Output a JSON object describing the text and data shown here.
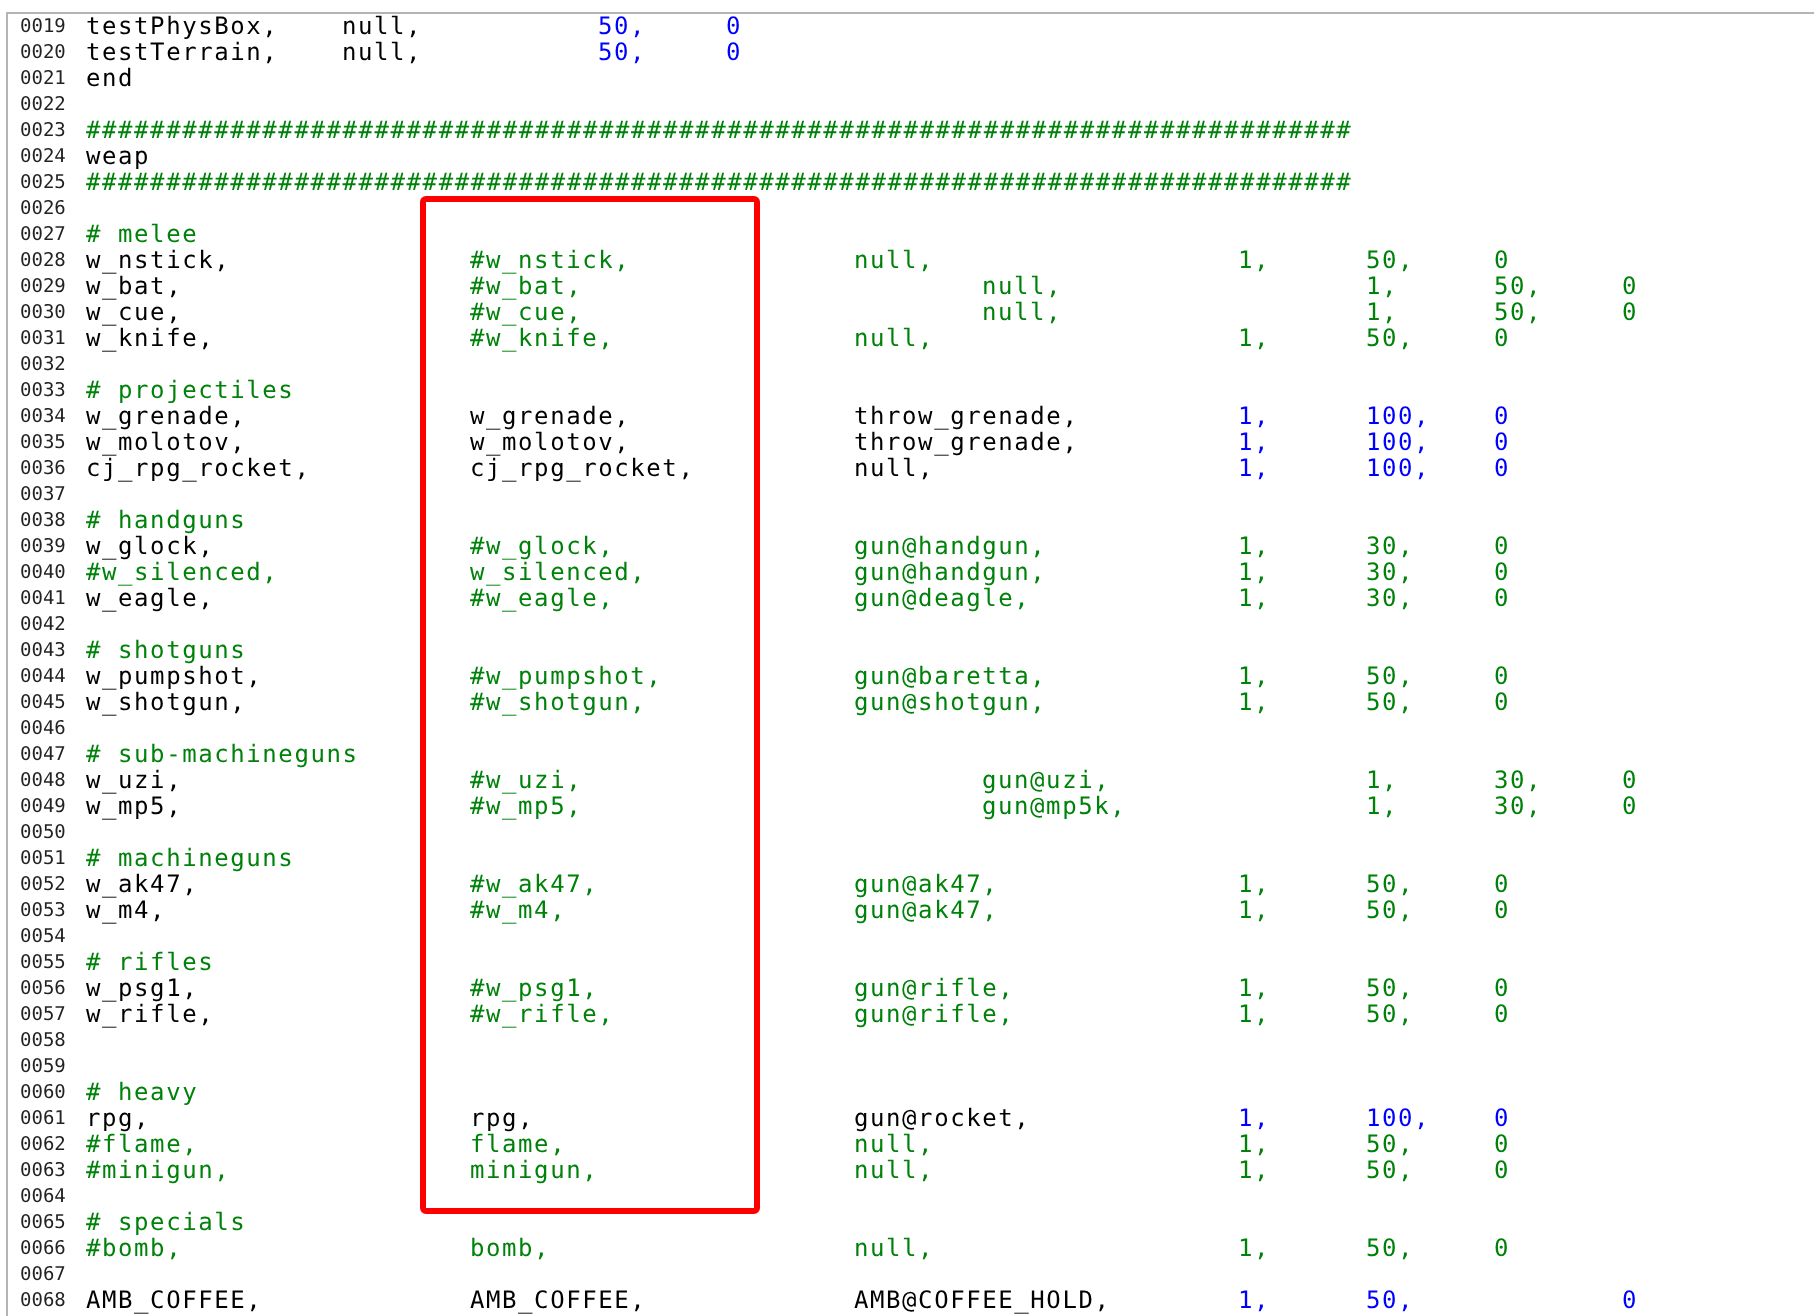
{
  "editor": {
    "sections": [
      {
        "boxed": false,
        "lines": [
          {
            "number": "0019",
            "tokens": [
              {
                "text": "testPhysBox,",
                "kind": "plain"
              },
              {
                "text": "\tnull,",
                "kind": "plain"
              },
              {
                "text": "\t\t50,",
                "kind": "number"
              },
              {
                "text": "\t0",
                "kind": "number"
              }
            ]
          },
          {
            "number": "0020",
            "tokens": [
              {
                "text": "testTerrain,",
                "kind": "plain"
              },
              {
                "text": "\tnull,",
                "kind": "plain"
              },
              {
                "text": "\t\t50,",
                "kind": "number"
              },
              {
                "text": "\t0",
                "kind": "number"
              }
            ]
          },
          {
            "number": "0021",
            "tokens": [
              {
                "text": "end",
                "kind": "plain"
              }
            ]
          },
          {
            "number": "0022"
          },
          {
            "number": "0023",
            "tokens": [
              {
                "text": "###############################################################################",
                "kind": "comment"
              }
            ]
          },
          {
            "number": "0024",
            "tokens": [
              {
                "text": "weap",
                "kind": "plain"
              }
            ]
          },
          {
            "number": "0025",
            "tokens": [
              {
                "text": "###############################################################################",
                "kind": "comment"
              }
            ]
          }
        ]
      },
      {
        "boxed": true,
        "lines": [
          {
            "number": "0026"
          },
          {
            "number": "0027",
            "tokens": [
              {
                "text": "# melee",
                "kind": "comment"
              }
            ]
          },
          {
            "number": "0028",
            "tokens": [
              {
                "text": "w_nstick,",
                "kind": "plain"
              },
              {
                "text": "\t\t#w_nstick,",
                "kind": "comment"
              },
              {
                "text": "\t\tnull,",
                "kind": "comment"
              },
              {
                "text": "\t\t\t1,",
                "kind": "comment"
              },
              {
                "text": "\t50,",
                "kind": "comment"
              },
              {
                "text": "\t0",
                "kind": "comment"
              }
            ]
          },
          {
            "number": "0029",
            "tokens": [
              {
                "text": "w_bat,",
                "kind": "plain"
              },
              {
                "text": "\t\t\t#w_bat,",
                "kind": "comment"
              },
              {
                "text": "\t\t\t\tnull,",
                "kind": "comment"
              },
              {
                "text": "\t\t\t1,",
                "kind": "comment"
              },
              {
                "text": "\t50,",
                "kind": "comment"
              },
              {
                "text": "\t0",
                "kind": "comment"
              }
            ]
          },
          {
            "number": "0030",
            "tokens": [
              {
                "text": "w_cue,",
                "kind": "plain"
              },
              {
                "text": "\t\t\t#w_cue,",
                "kind": "comment"
              },
              {
                "text": "\t\t\t\tnull,",
                "kind": "comment"
              },
              {
                "text": "\t\t\t1,",
                "kind": "comment"
              },
              {
                "text": "\t50,",
                "kind": "comment"
              },
              {
                "text": "\t0",
                "kind": "comment"
              }
            ]
          },
          {
            "number": "0031",
            "tokens": [
              {
                "text": "w_knife,",
                "kind": "plain"
              },
              {
                "text": "\t\t#w_knife,",
                "kind": "comment"
              },
              {
                "text": "\t\tnull,",
                "kind": "comment"
              },
              {
                "text": "\t\t\t1,",
                "kind": "comment"
              },
              {
                "text": "\t50,",
                "kind": "comment"
              },
              {
                "text": "\t0",
                "kind": "comment"
              }
            ]
          },
          {
            "number": "0032"
          },
          {
            "number": "0033",
            "tokens": [
              {
                "text": "# projectiles",
                "kind": "comment"
              }
            ]
          },
          {
            "number": "0034",
            "tokens": [
              {
                "text": "w_grenade,",
                "kind": "plain"
              },
              {
                "text": "\t\tw_grenade,",
                "kind": "plain"
              },
              {
                "text": "\t\tthrow_grenade,",
                "kind": "plain"
              },
              {
                "text": "\t\t1,",
                "kind": "number"
              },
              {
                "text": "\t100,",
                "kind": "number"
              },
              {
                "text": "\t0",
                "kind": "number"
              }
            ]
          },
          {
            "number": "0035",
            "tokens": [
              {
                "text": "w_molotov,",
                "kind": "plain"
              },
              {
                "text": "\t\tw_molotov,",
                "kind": "plain"
              },
              {
                "text": "\t\tthrow_grenade,",
                "kind": "plain"
              },
              {
                "text": "\t\t1,",
                "kind": "number"
              },
              {
                "text": "\t100,",
                "kind": "number"
              },
              {
                "text": "\t0",
                "kind": "number"
              }
            ]
          },
          {
            "number": "0036",
            "tokens": [
              {
                "text": "cj_rpg_rocket,",
                "kind": "plain"
              },
              {
                "text": "\t\tcj_rpg_rocket,",
                "kind": "plain"
              },
              {
                "text": "\t\tnull,",
                "kind": "plain"
              },
              {
                "text": "\t\t\t1,",
                "kind": "number"
              },
              {
                "text": "\t100,",
                "kind": "number"
              },
              {
                "text": "\t0",
                "kind": "number"
              }
            ]
          },
          {
            "number": "0037"
          },
          {
            "number": "0038",
            "tokens": [
              {
                "text": "# handguns",
                "kind": "comment"
              }
            ]
          },
          {
            "number": "0039",
            "tokens": [
              {
                "text": "w_glock,",
                "kind": "plain"
              },
              {
                "text": "\t\t#w_glock,",
                "kind": "comment"
              },
              {
                "text": "\t\tgun@handgun,",
                "kind": "comment"
              },
              {
                "text": "\t\t1,",
                "kind": "comment"
              },
              {
                "text": "\t30,",
                "kind": "comment"
              },
              {
                "text": "\t0",
                "kind": "comment"
              }
            ]
          },
          {
            "number": "0040",
            "tokens": [
              {
                "text": "#w_silenced,",
                "kind": "comment"
              },
              {
                "text": "\t\tw_silenced,",
                "kind": "comment"
              },
              {
                "text": "\t\tgun@handgun,",
                "kind": "comment"
              },
              {
                "text": "\t\t1,",
                "kind": "comment"
              },
              {
                "text": "\t30,",
                "kind": "comment"
              },
              {
                "text": "\t0",
                "kind": "comment"
              }
            ]
          },
          {
            "number": "0041",
            "tokens": [
              {
                "text": "w_eagle,",
                "kind": "plain"
              },
              {
                "text": "\t\t#w_eagle,",
                "kind": "comment"
              },
              {
                "text": "\t\tgun@deagle,",
                "kind": "comment"
              },
              {
                "text": "\t\t1,",
                "kind": "comment"
              },
              {
                "text": "\t30,",
                "kind": "comment"
              },
              {
                "text": "\t0",
                "kind": "comment"
              }
            ]
          },
          {
            "number": "0042"
          },
          {
            "number": "0043",
            "tokens": [
              {
                "text": "# shotguns",
                "kind": "comment"
              }
            ]
          },
          {
            "number": "0044",
            "tokens": [
              {
                "text": "w_pumpshot,",
                "kind": "plain"
              },
              {
                "text": "\t\t#w_pumpshot,",
                "kind": "comment"
              },
              {
                "text": "\t\tgun@baretta,",
                "kind": "comment"
              },
              {
                "text": "\t\t1,",
                "kind": "comment"
              },
              {
                "text": "\t50,",
                "kind": "comment"
              },
              {
                "text": "\t0",
                "kind": "comment"
              }
            ]
          },
          {
            "number": "0045",
            "tokens": [
              {
                "text": "w_shotgun,",
                "kind": "plain"
              },
              {
                "text": "\t\t#w_shotgun,",
                "kind": "comment"
              },
              {
                "text": "\t\tgun@shotgun,",
                "kind": "comment"
              },
              {
                "text": "\t\t1,",
                "kind": "comment"
              },
              {
                "text": "\t50,",
                "kind": "comment"
              },
              {
                "text": "\t0",
                "kind": "comment"
              }
            ]
          },
          {
            "number": "0046"
          },
          {
            "number": "0047",
            "tokens": [
              {
                "text": "# sub-machineguns",
                "kind": "comment"
              }
            ]
          },
          {
            "number": "0048",
            "tokens": [
              {
                "text": "w_uzi,",
                "kind": "plain"
              },
              {
                "text": "\t\t\t#w_uzi,",
                "kind": "comment"
              },
              {
                "text": "\t\t\t\tgun@uzi,",
                "kind": "comment"
              },
              {
                "text": "\t\t1,",
                "kind": "comment"
              },
              {
                "text": "\t30,",
                "kind": "comment"
              },
              {
                "text": "\t0",
                "kind": "comment"
              }
            ]
          },
          {
            "number": "0049",
            "tokens": [
              {
                "text": "w_mp5,",
                "kind": "plain"
              },
              {
                "text": "\t\t\t#w_mp5,",
                "kind": "comment"
              },
              {
                "text": "\t\t\t\tgun@mp5k,",
                "kind": "comment"
              },
              {
                "text": "\t\t1,",
                "kind": "comment"
              },
              {
                "text": "\t30,",
                "kind": "comment"
              },
              {
                "text": "\t0",
                "kind": "comment"
              }
            ]
          },
          {
            "number": "0050"
          },
          {
            "number": "0051",
            "tokens": [
              {
                "text": "# machineguns",
                "kind": "comment"
              }
            ]
          },
          {
            "number": "0052",
            "tokens": [
              {
                "text": "w_ak47,",
                "kind": "plain"
              },
              {
                "text": "\t\t\t#w_ak47,",
                "kind": "comment"
              },
              {
                "text": "\t\tgun@ak47,",
                "kind": "comment"
              },
              {
                "text": "\t\t1,",
                "kind": "comment"
              },
              {
                "text": "\t50,",
                "kind": "comment"
              },
              {
                "text": "\t0",
                "kind": "comment"
              }
            ]
          },
          {
            "number": "0053",
            "tokens": [
              {
                "text": "w_m4,",
                "kind": "plain"
              },
              {
                "text": "\t\t\t#w_m4,",
                "kind": "comment"
              },
              {
                "text": "\t\t\tgun@ak47,",
                "kind": "comment"
              },
              {
                "text": "\t\t1,",
                "kind": "comment"
              },
              {
                "text": "\t50,",
                "kind": "comment"
              },
              {
                "text": "\t0",
                "kind": "comment"
              }
            ]
          },
          {
            "number": "0054"
          },
          {
            "number": "0055",
            "tokens": [
              {
                "text": "# rifles",
                "kind": "comment"
              }
            ]
          },
          {
            "number": "0056",
            "tokens": [
              {
                "text": "w_psg1,",
                "kind": "plain"
              },
              {
                "text": "\t\t\t#w_psg1,",
                "kind": "comment"
              },
              {
                "text": "\t\tgun@rifle,",
                "kind": "comment"
              },
              {
                "text": "\t\t1,",
                "kind": "comment"
              },
              {
                "text": "\t50,",
                "kind": "comment"
              },
              {
                "text": "\t0",
                "kind": "comment"
              }
            ]
          },
          {
            "number": "0057",
            "tokens": [
              {
                "text": "w_rifle,",
                "kind": "plain"
              },
              {
                "text": "\t\t#w_rifle,",
                "kind": "comment"
              },
              {
                "text": "\t\tgun@rifle,",
                "kind": "comment"
              },
              {
                "text": "\t\t1,",
                "kind": "comment"
              },
              {
                "text": "\t50,",
                "kind": "comment"
              },
              {
                "text": "\t0",
                "kind": "comment"
              }
            ]
          },
          {
            "number": "0058"
          },
          {
            "number": "0059"
          },
          {
            "number": "0060",
            "tokens": [
              {
                "text": "# heavy",
                "kind": "comment"
              }
            ]
          },
          {
            "number": "0061",
            "tokens": [
              {
                "text": "rpg,",
                "kind": "plain"
              },
              {
                "text": "\t\t\trpg,",
                "kind": "plain"
              },
              {
                "text": "\t\t\tgun@rocket,",
                "kind": "plain"
              },
              {
                "text": "\t\t1,",
                "kind": "number"
              },
              {
                "text": "\t100,",
                "kind": "number"
              },
              {
                "text": "\t0",
                "kind": "number"
              }
            ]
          },
          {
            "number": "0062",
            "tokens": [
              {
                "text": "#flame,",
                "kind": "comment"
              },
              {
                "text": "\t\t\tflame,",
                "kind": "comment"
              },
              {
                "text": "\t\t\tnull,",
                "kind": "comment"
              },
              {
                "text": "\t\t\t1,",
                "kind": "comment"
              },
              {
                "text": "\t50,",
                "kind": "comment"
              },
              {
                "text": "\t0",
                "kind": "comment"
              }
            ]
          },
          {
            "number": "0063",
            "tokens": [
              {
                "text": "#minigun,",
                "kind": "comment"
              },
              {
                "text": "\t\tminigun,",
                "kind": "comment"
              },
              {
                "text": "\t\tnull,",
                "kind": "comment"
              },
              {
                "text": "\t\t\t1,",
                "kind": "comment"
              },
              {
                "text": "\t50,",
                "kind": "comment"
              },
              {
                "text": "\t0",
                "kind": "comment"
              }
            ]
          },
          {
            "number": "0064"
          }
        ]
      },
      {
        "boxed": false,
        "lines": [
          {
            "number": "0065",
            "tokens": [
              {
                "text": "# specials",
                "kind": "comment"
              }
            ]
          },
          {
            "number": "0066",
            "tokens": [
              {
                "text": "#bomb,",
                "kind": "comment"
              },
              {
                "text": "\t\t\tbomb,",
                "kind": "comment"
              },
              {
                "text": "\t\t\tnull,",
                "kind": "comment"
              },
              {
                "text": "\t\t\t1,",
                "kind": "comment"
              },
              {
                "text": "\t50,",
                "kind": "comment"
              },
              {
                "text": "\t0",
                "kind": "comment"
              }
            ]
          },
          {
            "number": "0067"
          },
          {
            "number": "0068",
            "tokens": [
              {
                "text": "AMB_COFFEE,",
                "kind": "plain"
              },
              {
                "text": "\t\tAMB_COFFEE,",
                "kind": "plain"
              },
              {
                "text": "\t\tAMB@COFFEE_HOLD,",
                "kind": "plain"
              },
              {
                "text": "\t1,",
                "kind": "number"
              },
              {
                "text": "\t50,",
                "kind": "number"
              },
              {
                "text": "\t\t0",
                "kind": "number"
              }
            ]
          }
        ]
      }
    ]
  }
}
